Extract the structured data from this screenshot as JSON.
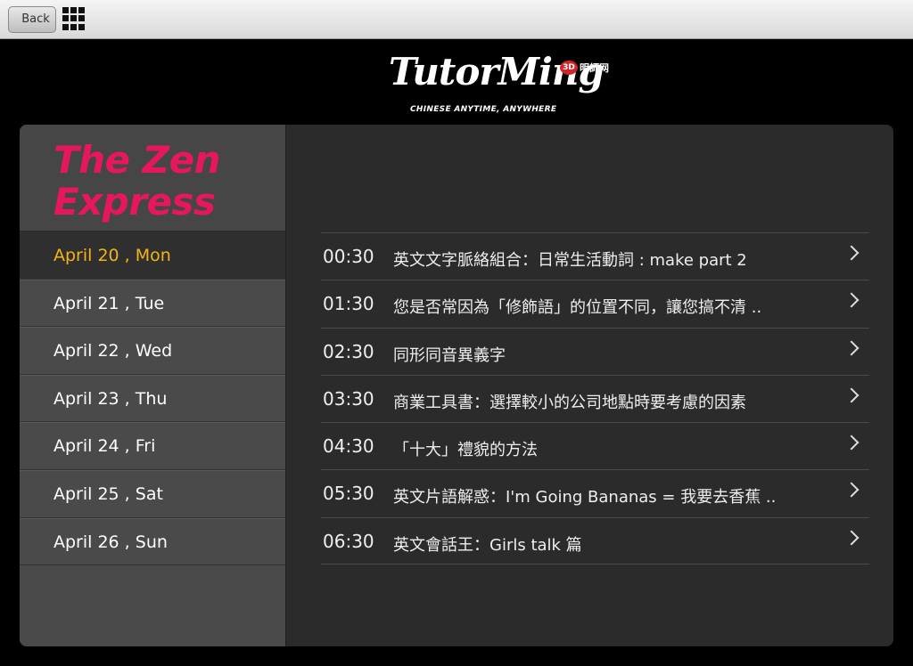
{
  "toolbar": {
    "back_label": "Back"
  },
  "logo": {
    "main": "TutorMing",
    "tagline": "CHINESE ANYTIME, ANYWHERE",
    "badge": "3D",
    "cn": "明師网"
  },
  "show": {
    "title_line1": "The Zen",
    "title_line2": "Express"
  },
  "dates": [
    {
      "label": "April 20 , Mon",
      "active": true
    },
    {
      "label": "April 21 , Tue",
      "active": false
    },
    {
      "label": "April 22 , Wed",
      "active": false
    },
    {
      "label": "April 23 , Thu",
      "active": false
    },
    {
      "label": "April 24 , Fri",
      "active": false
    },
    {
      "label": "April 25 , Sat",
      "active": false
    },
    {
      "label": "April 26 , Sun",
      "active": false
    }
  ],
  "schedule": [
    {
      "time": "00:30",
      "title": "英文文字脈絡組合：日常生活動詞 : make part 2"
    },
    {
      "time": "01:30",
      "title": "您是否常因為「修飾語」的位置不同，讓您搞不清 .."
    },
    {
      "time": "02:30",
      "title": "同形同音異義字"
    },
    {
      "time": "03:30",
      "title": "商業工具書：選擇較小的公司地點時要考慮的因素"
    },
    {
      "time": "04:30",
      "title": "「十大」禮貌的方法"
    },
    {
      "time": "05:30",
      "title": "英文片語解惑：I'm Going Bananas = 我要去香蕉 .."
    },
    {
      "time": "06:30",
      "title": "英文會話王：Girls talk 篇"
    }
  ]
}
